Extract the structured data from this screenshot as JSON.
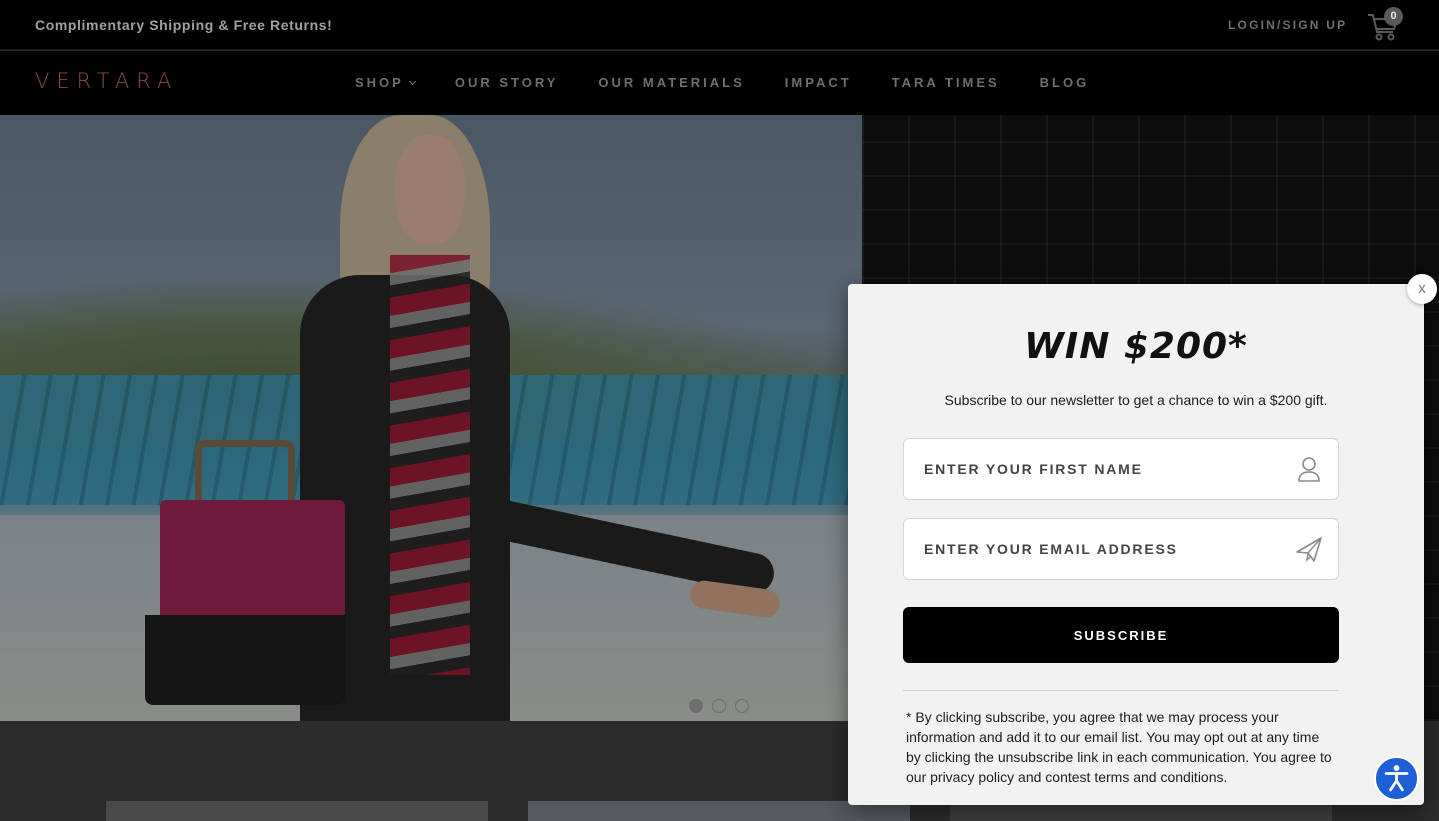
{
  "topbar": {
    "shipping_text": "Complimentary Shipping & Free Returns!",
    "login_text": "LOGIN/SIGN UP",
    "cart_count": "0",
    "cart_icon": "cart-icon"
  },
  "brand": {
    "logo_text": "VERTARA"
  },
  "nav": {
    "items": [
      {
        "label": "SHOP",
        "has_dropdown": true
      },
      {
        "label": "OUR STORY"
      },
      {
        "label": "OUR MATERIALS"
      },
      {
        "label": "IMPACT"
      },
      {
        "label": "TARA TIMES"
      },
      {
        "label": "BLOG"
      }
    ]
  },
  "hero": {
    "slide_count": 3,
    "active_slide": 1
  },
  "popup": {
    "close_label": "x",
    "title": "WIN $200*",
    "subtitle": "Subscribe to our newsletter to get a chance to win a $200 gift.",
    "first_name_placeholder": "ENTER YOUR FIRST NAME",
    "email_placeholder": "ENTER YOUR EMAIL ADDRESS",
    "subscribe_label": "SUBSCRIBE",
    "disclaimer": "* By clicking subscribe, you agree that we may process your information and add it to our email list. You may opt out at any time by clicking the unsubscribe link in each communication. You agree to our privacy policy and contest terms and conditions."
  },
  "colors": {
    "accent_logo": "#8a4f3d",
    "accessibility_button": "#1d5fd6"
  }
}
